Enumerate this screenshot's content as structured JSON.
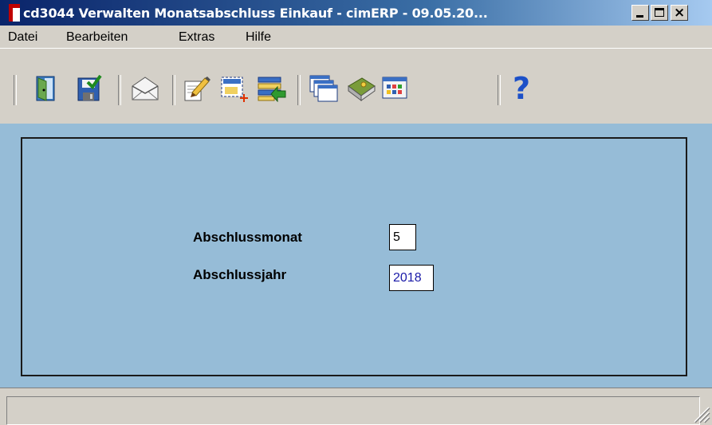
{
  "window": {
    "title": "cd3044 Verwalten Monatsabschluss Einkauf - cimERP - 09.05.20...",
    "buttons": {
      "minimize_icon": "minimize-icon",
      "maximize_icon": "maximize-icon",
      "close_icon": "close-icon",
      "close_glyph": "×"
    }
  },
  "menu": {
    "items": [
      {
        "label": "Datei"
      },
      {
        "label": "Bearbeiten"
      },
      {
        "label": "Extras"
      },
      {
        "label": "Hilfe"
      }
    ]
  },
  "toolbar": {
    "icons": [
      "exit-door-icon",
      "save-icon",
      "mail-icon",
      "edit-document-icon",
      "new-record-icon",
      "import-list-icon",
      "windows-icon",
      "book-icon",
      "grid-icon",
      "help-icon"
    ],
    "help_glyph": "?"
  },
  "form": {
    "abschlussmonat_label": "Abschlussmonat",
    "abschlussmonat_value": "5",
    "abschlussjahr_label": "Abschlussjahr",
    "abschlussjahr_value": "2018"
  },
  "colors": {
    "titlebar_start": "#0a246a",
    "client_background": "#96bcd7",
    "year_value_text": "#1a1aa8"
  }
}
